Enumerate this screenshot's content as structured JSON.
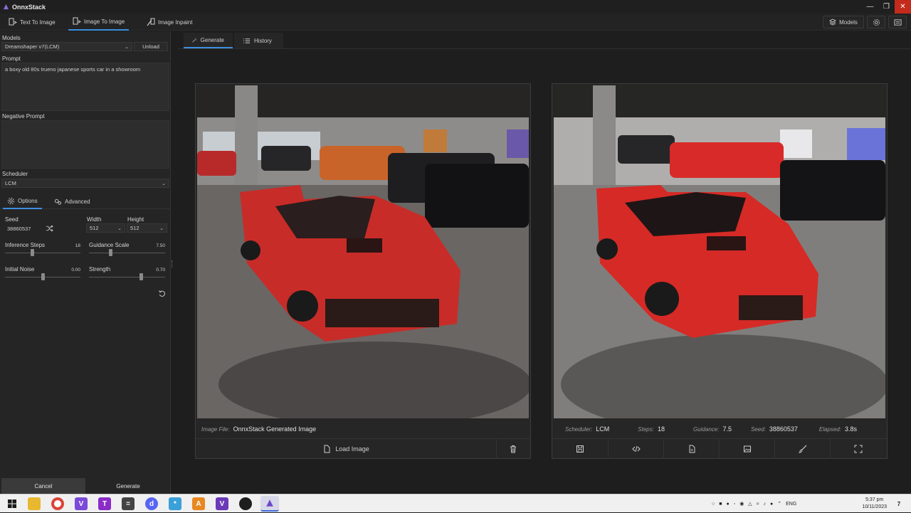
{
  "window": {
    "title": "OnnxStack",
    "accent": "#3d8fe0",
    "controls": [
      "minimize",
      "maximize",
      "close"
    ]
  },
  "top_tabs": [
    {
      "label": "Text To Image",
      "icon": "text-to-image-icon",
      "active": false
    },
    {
      "label": "Image To Image",
      "icon": "image-to-image-icon",
      "active": true
    },
    {
      "label": "Image Inpaint",
      "icon": "image-inpaint-icon",
      "active": false
    }
  ],
  "top_right": {
    "models_label": "Models"
  },
  "sidebar": {
    "models_label": "Models",
    "model_value": "Dreamshaper v7(LCM)",
    "unload_label": "Unload",
    "prompt_label": "Prompt",
    "prompt_value": "a boxy old 80s trueno japanese sports car in a showroom",
    "negative_prompt_label": "Negative Prompt",
    "negative_prompt_value": "",
    "scheduler_label": "Scheduler",
    "scheduler_value": "LCM",
    "tabs": [
      {
        "label": "Options",
        "active": true
      },
      {
        "label": "Advanced",
        "active": false
      }
    ],
    "seed_label": "Seed",
    "seed_value": "38860537",
    "width_label": "Width",
    "width_value": "512",
    "height_label": "Height",
    "height_value": "512",
    "inference_steps_label": "Inference Steps",
    "inference_steps_value": "18",
    "inference_steps_fraction": 0.36,
    "guidance_scale_label": "Guidance Scale",
    "guidance_scale_value": "7.50",
    "guidance_scale_fraction": 0.27,
    "initial_noise_label": "Initial Noise",
    "initial_noise_value": "0.00",
    "initial_noise_fraction": 0.5,
    "strength_label": "Strength",
    "strength_value": "0.70",
    "strength_fraction": 0.7,
    "cancel_label": "Cancel",
    "generate_label": "Generate"
  },
  "main_tabs": [
    {
      "label": "Generate",
      "active": true
    },
    {
      "label": "History",
      "active": false
    }
  ],
  "input_panel": {
    "image_file_label": "Image File:",
    "image_file_value": "OnnxStack Generated Image",
    "load_image_label": "Load Image"
  },
  "output_panel": {
    "scheduler_label": "Scheduler:",
    "scheduler_value": "LCM",
    "steps_label": "Steps:",
    "steps_value": "18",
    "guidance_label": "Guidance:",
    "guidance_value": "7.5",
    "seed_label": "Seed:",
    "seed_value": "38860537",
    "elapsed_label": "Elapsed:",
    "elapsed_value": "3.8s",
    "actions": [
      "save-icon",
      "code-icon",
      "document-icon",
      "image-icon",
      "brush-icon",
      "fullscreen-icon"
    ]
  },
  "taskbar": {
    "language": "ENG",
    "time": "5:37 pm",
    "date": "10/11/2023",
    "notification_count": "7"
  }
}
